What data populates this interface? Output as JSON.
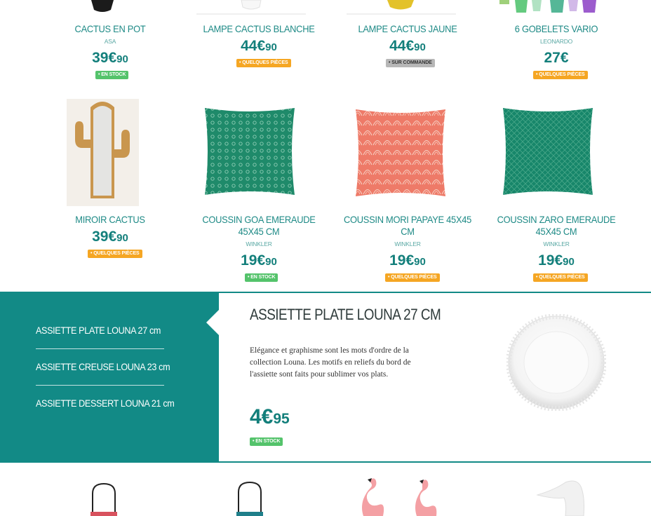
{
  "products_row1": [
    {
      "name": "CACTUS EN POT",
      "brand": "ASA",
      "price_main": "39€",
      "price_cents": "90",
      "badge": "• EN STOCK",
      "badge_color": "#54c36b"
    },
    {
      "name": "LAMPE CACTUS BLANCHE",
      "brand": "",
      "price_main": "44€",
      "price_cents": "90",
      "badge": "• QUELQUES PIÈCES",
      "badge_color": "#f5a623"
    },
    {
      "name": "LAMPE CACTUS JAUNE",
      "brand": "",
      "price_main": "44€",
      "price_cents": "90",
      "badge": "• SUR COMMANDE",
      "badge_color": "#b7b7b7"
    },
    {
      "name": "6 GOBELETS VARIO",
      "brand": "LEONARDO",
      "price_main": "27€",
      "price_cents": "",
      "badge": "• QUELQUES PIÈCES",
      "badge_color": "#f5a623"
    }
  ],
  "products_row2": [
    {
      "name": "MIROIR CACTUS",
      "brand": "",
      "price_main": "39€",
      "price_cents": "90",
      "badge": "• QUELQUES PIÈCES",
      "badge_color": "#f5a623"
    },
    {
      "name_line1": "COUSSIN GOA EMERAUDE",
      "name_line2": "45X45 CM",
      "brand": "WINKLER",
      "price_main": "19€",
      "price_cents": "90",
      "badge": "• EN STOCK",
      "badge_color": "#54c36b"
    },
    {
      "name_line1": "COUSSIN MORI PAPAYE 45X45",
      "name_line2": "CM",
      "brand": "WINKLER",
      "price_main": "19€",
      "price_cents": "90",
      "badge": "• QUELQUES PIÈCES",
      "badge_color": "#f5a623"
    },
    {
      "name_line1": "COUSSIN ZARO EMERAUDE",
      "name_line2": "45X45 CM",
      "brand": "WINKLER",
      "price_main": "19€",
      "price_cents": "90",
      "badge": "• QUELQUES PIÈCES",
      "badge_color": "#f5a623"
    }
  ],
  "banner": {
    "menu": [
      "ASSIETTE PLATE LOUNA 27 cm",
      "ASSIETTE CREUSE LOUNA 23 cm",
      "ASSIETTE DESSERT LOUNA 21 cm"
    ],
    "title": "ASSIETTE PLATE LOUNA 27 CM",
    "desc_line1": "Elégance et graphisme sont les mots d'ordre de la",
    "desc_line2": "collection Louna. Les motifs en reliefs du bord de",
    "desc_line3": "l'assiette sont faits pour sublimer vos plats.",
    "price_main": "4€",
    "price_cents": "95",
    "badge": "• EN STOCK"
  },
  "colors": {
    "accent": "#128a86",
    "price": "#137f7b",
    "in_stock": "#54c36b",
    "few_left": "#f5a623",
    "on_order": "#b7b7b7"
  }
}
